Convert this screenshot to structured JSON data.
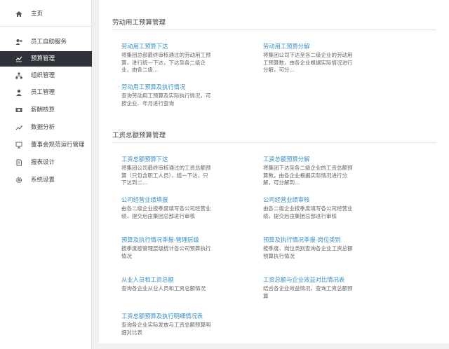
{
  "sidebar": {
    "items": [
      {
        "label": "主页",
        "icon": "home-icon"
      },
      {
        "label": "员工自助服务",
        "icon": "user-card-icon"
      },
      {
        "label": "预算管理",
        "icon": "budget-chart-icon",
        "active": true
      },
      {
        "label": "组织管理",
        "icon": "org-tree-icon"
      },
      {
        "label": "员工管理",
        "icon": "person-icon"
      },
      {
        "label": "薪酬核算",
        "icon": "salary-icon"
      },
      {
        "label": "数据分析",
        "icon": "analysis-icon"
      },
      {
        "label": "董事会规范运行管理",
        "icon": "board-icon"
      },
      {
        "label": "报表设计",
        "icon": "report-icon"
      },
      {
        "label": "系统设置",
        "icon": "settings-icon"
      }
    ]
  },
  "main": {
    "sections": [
      {
        "title": "劳动用工预算管理",
        "cards": [
          {
            "title": "劳动用工预算下达",
            "desc": "将集团总部最终审核通过的劳动用工预算，进行统一下达，下达至各二级企业，由各二级..."
          },
          {
            "title": "劳动用工预算分解",
            "desc": "将集团公司下达至各二级企业的劳动用工预算数，由各企业根据实际情况进行分解，可分..."
          },
          {
            "title": "劳动用工预算及执行情况",
            "desc": "查询劳动用工预算及实际执行情况，可按企业、年月进行查询"
          }
        ]
      },
      {
        "title": "工资总额预算管理",
        "cards": [
          {
            "title": "工资总额预算下达",
            "desc": "将集团公司最终审核通过的工资总额预算（只包含职工人员），统一下达，只下达到二..."
          },
          {
            "title": "工资总额预算分解",
            "desc": "将集团下达至各二级企业的工资总额预算数，由各企业根据实际情况进行分解，可分解到..."
          },
          {
            "title": "公司经营业绩填报",
            "desc": "由各二级企业按季度填写各公司经营业绩，提交后由集团总部进行审核"
          },
          {
            "title": "公司经营业绩审核",
            "desc": "由各二级企业按季度填写各公司经营业绩，提交后由集团总部进行审核"
          },
          {
            "title": "预算及执行情况季报-管理层级",
            "desc": "按季度按管理层级统计各公司预算执行情况"
          },
          {
            "title": "预算及执行情况季报-岗位类别",
            "desc": "按季度、岗位类别查询各企业工资总额预算执行情况"
          },
          {
            "title": "从业人员和工资总额",
            "desc": "查询各企业从业人员和工资总额情况"
          },
          {
            "title": "工资总额与企业效益对比情况表",
            "desc": "结合各企业效益情况，查询工资总额预算"
          },
          {
            "title": "工资总额预算及执行明细情况表",
            "desc": "查询各企业实际发放与工资总额预算明细对比表"
          }
        ]
      }
    ]
  }
}
